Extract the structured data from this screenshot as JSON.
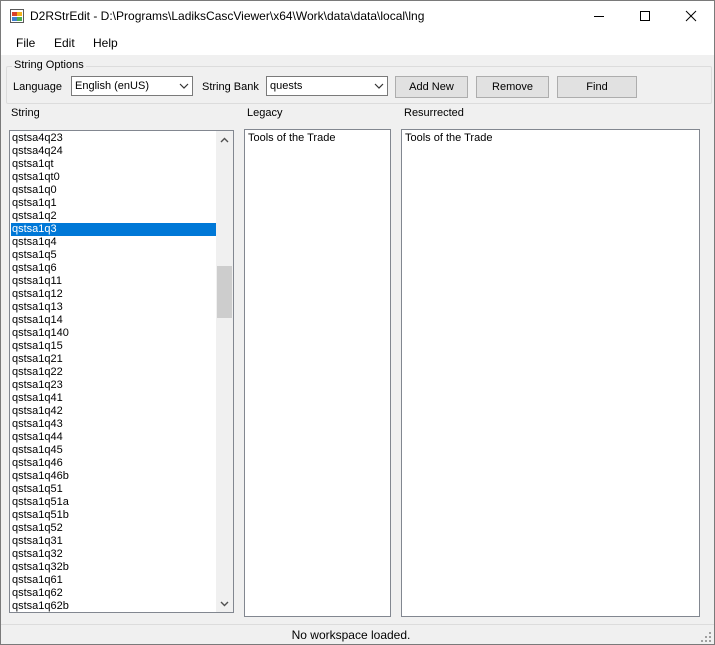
{
  "window": {
    "title": "D2RStrEdit - D:\\Programs\\LadiksCascViewer\\x64\\Work\\data\\data\\local\\lng",
    "controls": [
      "minimize-icon",
      "maximize-icon",
      "close-icon"
    ]
  },
  "menu": {
    "file": "File",
    "edit": "Edit",
    "help": "Help"
  },
  "string_options": {
    "group_title": "String Options",
    "language_label": "Language",
    "language_value": "English (enUS)",
    "string_bank_label": "String Bank",
    "string_bank_value": "quests",
    "add_new": "Add New",
    "remove": "Remove",
    "find": "Find"
  },
  "columns": {
    "string": "String",
    "legacy": "Legacy",
    "resurrected": "Resurrected"
  },
  "string_list": {
    "selected": "qstsa1q3",
    "items": [
      "qstsa4q23",
      "qstsa4q24",
      "qstsa1qt",
      "qstsa1qt0",
      "qstsa1q0",
      "qstsa1q1",
      "qstsa1q2",
      "qstsa1q3",
      "qstsa1q4",
      "qstsa1q5",
      "qstsa1q6",
      "qstsa1q11",
      "qstsa1q12",
      "qstsa1q13",
      "qstsa1q14",
      "qstsa1q140",
      "qstsa1q15",
      "qstsa1q21",
      "qstsa1q22",
      "qstsa1q23",
      "qstsa1q41",
      "qstsa1q42",
      "qstsa1q43",
      "qstsa1q44",
      "qstsa1q45",
      "qstsa1q46",
      "qstsa1q46b",
      "qstsa1q51",
      "qstsa1q51a",
      "qstsa1q51b",
      "qstsa1q52",
      "qstsa1q31",
      "qstsa1q32",
      "qstsa1q32b",
      "qstsa1q61",
      "qstsa1q62",
      "qstsa1q62b"
    ]
  },
  "legacy_text": "Tools of the Trade",
  "resurrected_text": "Tools of the Trade",
  "status": "No workspace loaded."
}
